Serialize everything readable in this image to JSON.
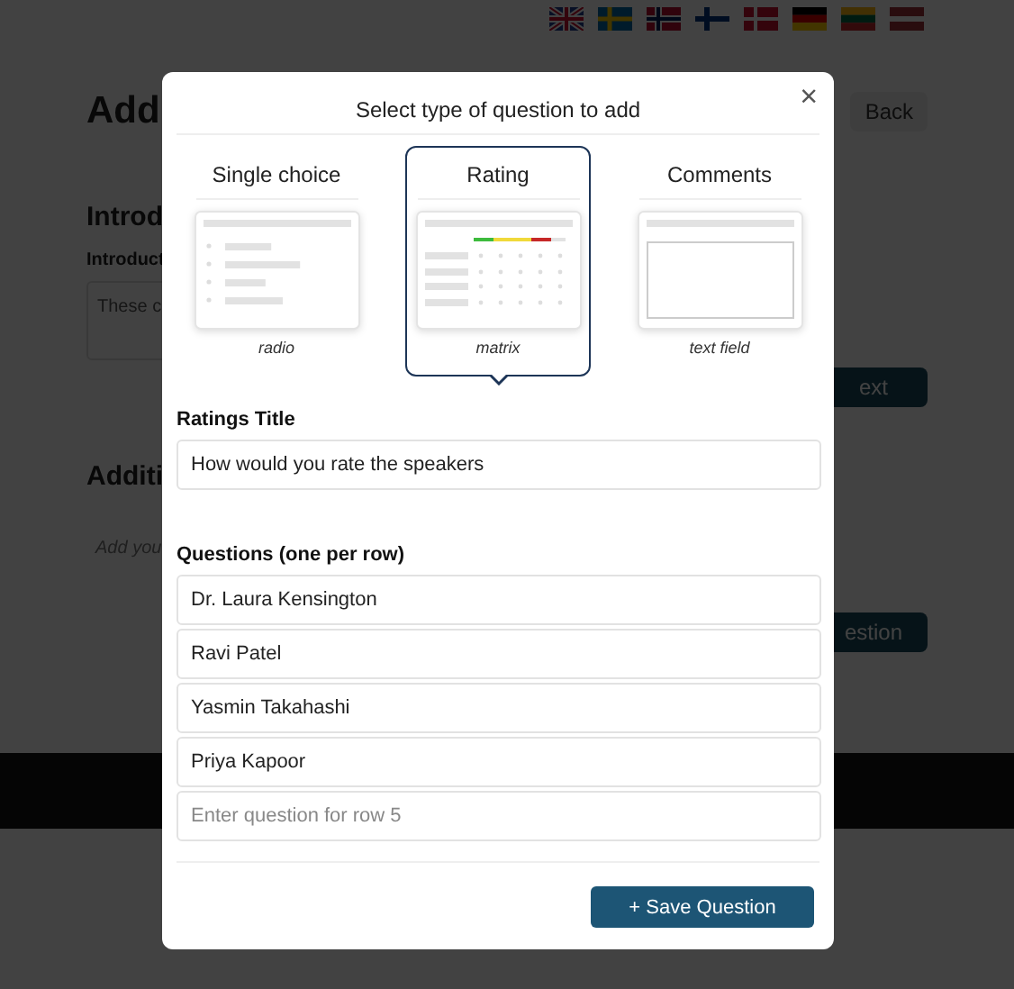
{
  "background_page": {
    "title": "Add",
    "back_button": "Back",
    "section_title": "Introd",
    "field_label": "Introduct",
    "field_value": "These c",
    "next_button": "ext",
    "section2_title": "Additi",
    "section2_hint": "Add you",
    "add_button": "estion"
  },
  "modal": {
    "title": "Select type of question to add",
    "close": "×",
    "question_types": [
      {
        "label": "Single choice",
        "caption": "radio",
        "kind": "radio",
        "selected": false
      },
      {
        "label": "Rating",
        "caption": "matrix",
        "kind": "matrix",
        "selected": true
      },
      {
        "label": "Comments",
        "caption": "text field",
        "kind": "textfield",
        "selected": false
      }
    ],
    "ratings_title_label": "Ratings Title",
    "ratings_title_value": "How would you rate the speakers",
    "questions_label": "Questions (one per row)",
    "questions": [
      {
        "value": "Dr. Laura Kensington"
      },
      {
        "value": "Ravi Patel"
      },
      {
        "value": "Yasmin Takahashi"
      },
      {
        "value": "Priya Kapoor"
      },
      {
        "placeholder": "Enter question for row 5"
      }
    ],
    "save_button": "+ Save Question"
  }
}
